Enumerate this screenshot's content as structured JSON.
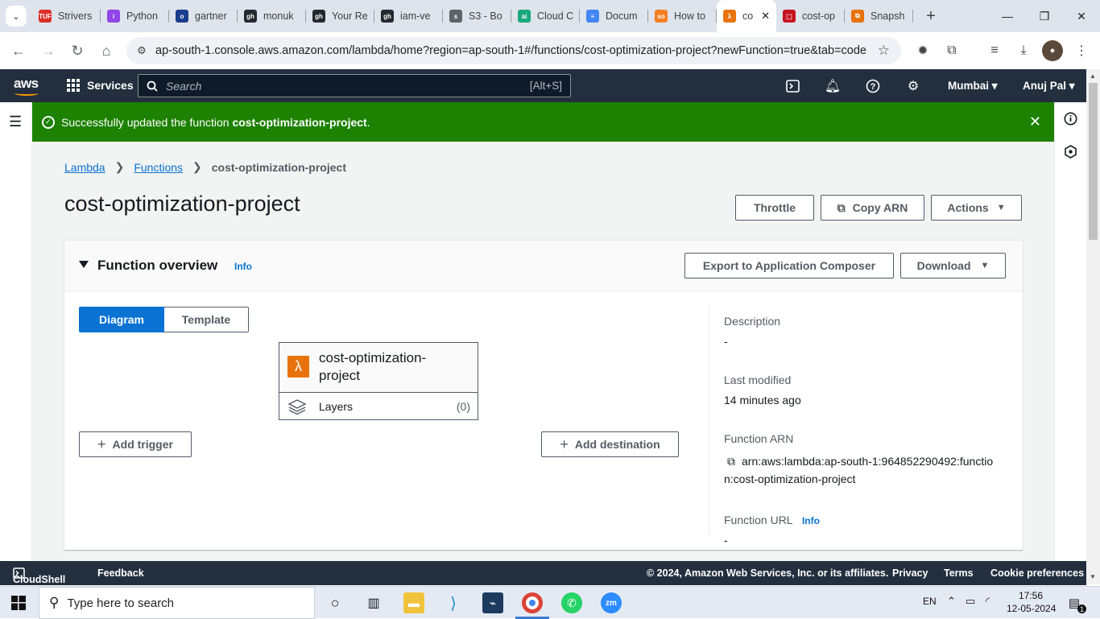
{
  "browser": {
    "tabs": [
      {
        "title": "Strivers",
        "icon_color": "#d93025",
        "icon_text": "TUF"
      },
      {
        "title": "Python",
        "icon_color": "#9146e8",
        "icon_text": "i"
      },
      {
        "title": "gartner",
        "icon_color": "#1a3e8c",
        "icon_text": "o"
      },
      {
        "title": "monuk",
        "icon_color": "#24292f",
        "icon_text": "gh"
      },
      {
        "title": "Your Re",
        "icon_color": "#24292f",
        "icon_text": "gh"
      },
      {
        "title": "iam-ve",
        "icon_color": "#24292f",
        "icon_text": "gh"
      },
      {
        "title": "S3 - Bo",
        "icon_color": "#5f6368",
        "icon_text": "s"
      },
      {
        "title": "Cloud C",
        "icon_color": "#19a97b",
        "icon_text": "ai"
      },
      {
        "title": "Docum",
        "icon_color": "#4285f4",
        "icon_text": "≡"
      },
      {
        "title": "How to",
        "icon_color": "#f48024",
        "icon_text": "so"
      }
    ],
    "active_tab": {
      "title": "co",
      "icon_color": "#e8730c",
      "icon_text": "λ"
    },
    "trailing_tabs": [
      {
        "title": "cost-op",
        "icon_color": "#c7131f",
        "icon_text": "⬚"
      },
      {
        "title": "Snapsh",
        "icon_color": "#e8730c",
        "icon_text": "⧉"
      }
    ],
    "url": "ap-south-1.console.aws.amazon.com/lambda/home?region=ap-south-1#/functions/cost-optimization-project?newFunction=true&tab=code"
  },
  "aws_nav": {
    "logo": "aws",
    "services_label": "Services",
    "search_placeholder": "Search",
    "search_shortcut": "[Alt+S]",
    "region": "Mumbai",
    "user": "Anuj Pal"
  },
  "banner": {
    "prefix": "Successfully updated the function ",
    "function_name": "cost-optimization-project",
    "suffix": "."
  },
  "breadcrumb": {
    "items": [
      "Lambda",
      "Functions"
    ],
    "current": "cost-optimization-project"
  },
  "page": {
    "title": "cost-optimization-project",
    "throttle_label": "Throttle",
    "copy_arn_label": "Copy ARN",
    "actions_label": "Actions"
  },
  "overview": {
    "heading": "Function overview",
    "info_label": "Info",
    "export_label": "Export to Application Composer",
    "download_label": "Download",
    "tabs": [
      "Diagram",
      "Template"
    ],
    "function_name_line1": "cost-optimization-",
    "function_name_line2": "project",
    "layers_label": "Layers",
    "layers_count": "(0)",
    "add_trigger_label": "Add trigger",
    "add_destination_label": "Add destination",
    "description_label": "Description",
    "description_value": "-",
    "last_modified_label": "Last modified",
    "last_modified_value": "14 minutes ago",
    "arn_label": "Function ARN",
    "arn_line1": "arn:aws:lambda:ap-south-1:964852290492:functio",
    "arn_line2": "n:cost-optimization-project",
    "url_label": "Function URL",
    "url_info": "Info",
    "url_value": "-"
  },
  "footer": {
    "cloudshell": "CloudShell",
    "feedback": "Feedback",
    "copyright": "© 2024, Amazon Web Services, Inc. or its affiliates.",
    "privacy": "Privacy",
    "terms": "Terms",
    "cookies": "Cookie preferences"
  },
  "taskbar": {
    "search_placeholder": "Type here to search",
    "lang": "EN",
    "time": "17:56",
    "date": "12-05-2024",
    "notifications": "1"
  }
}
